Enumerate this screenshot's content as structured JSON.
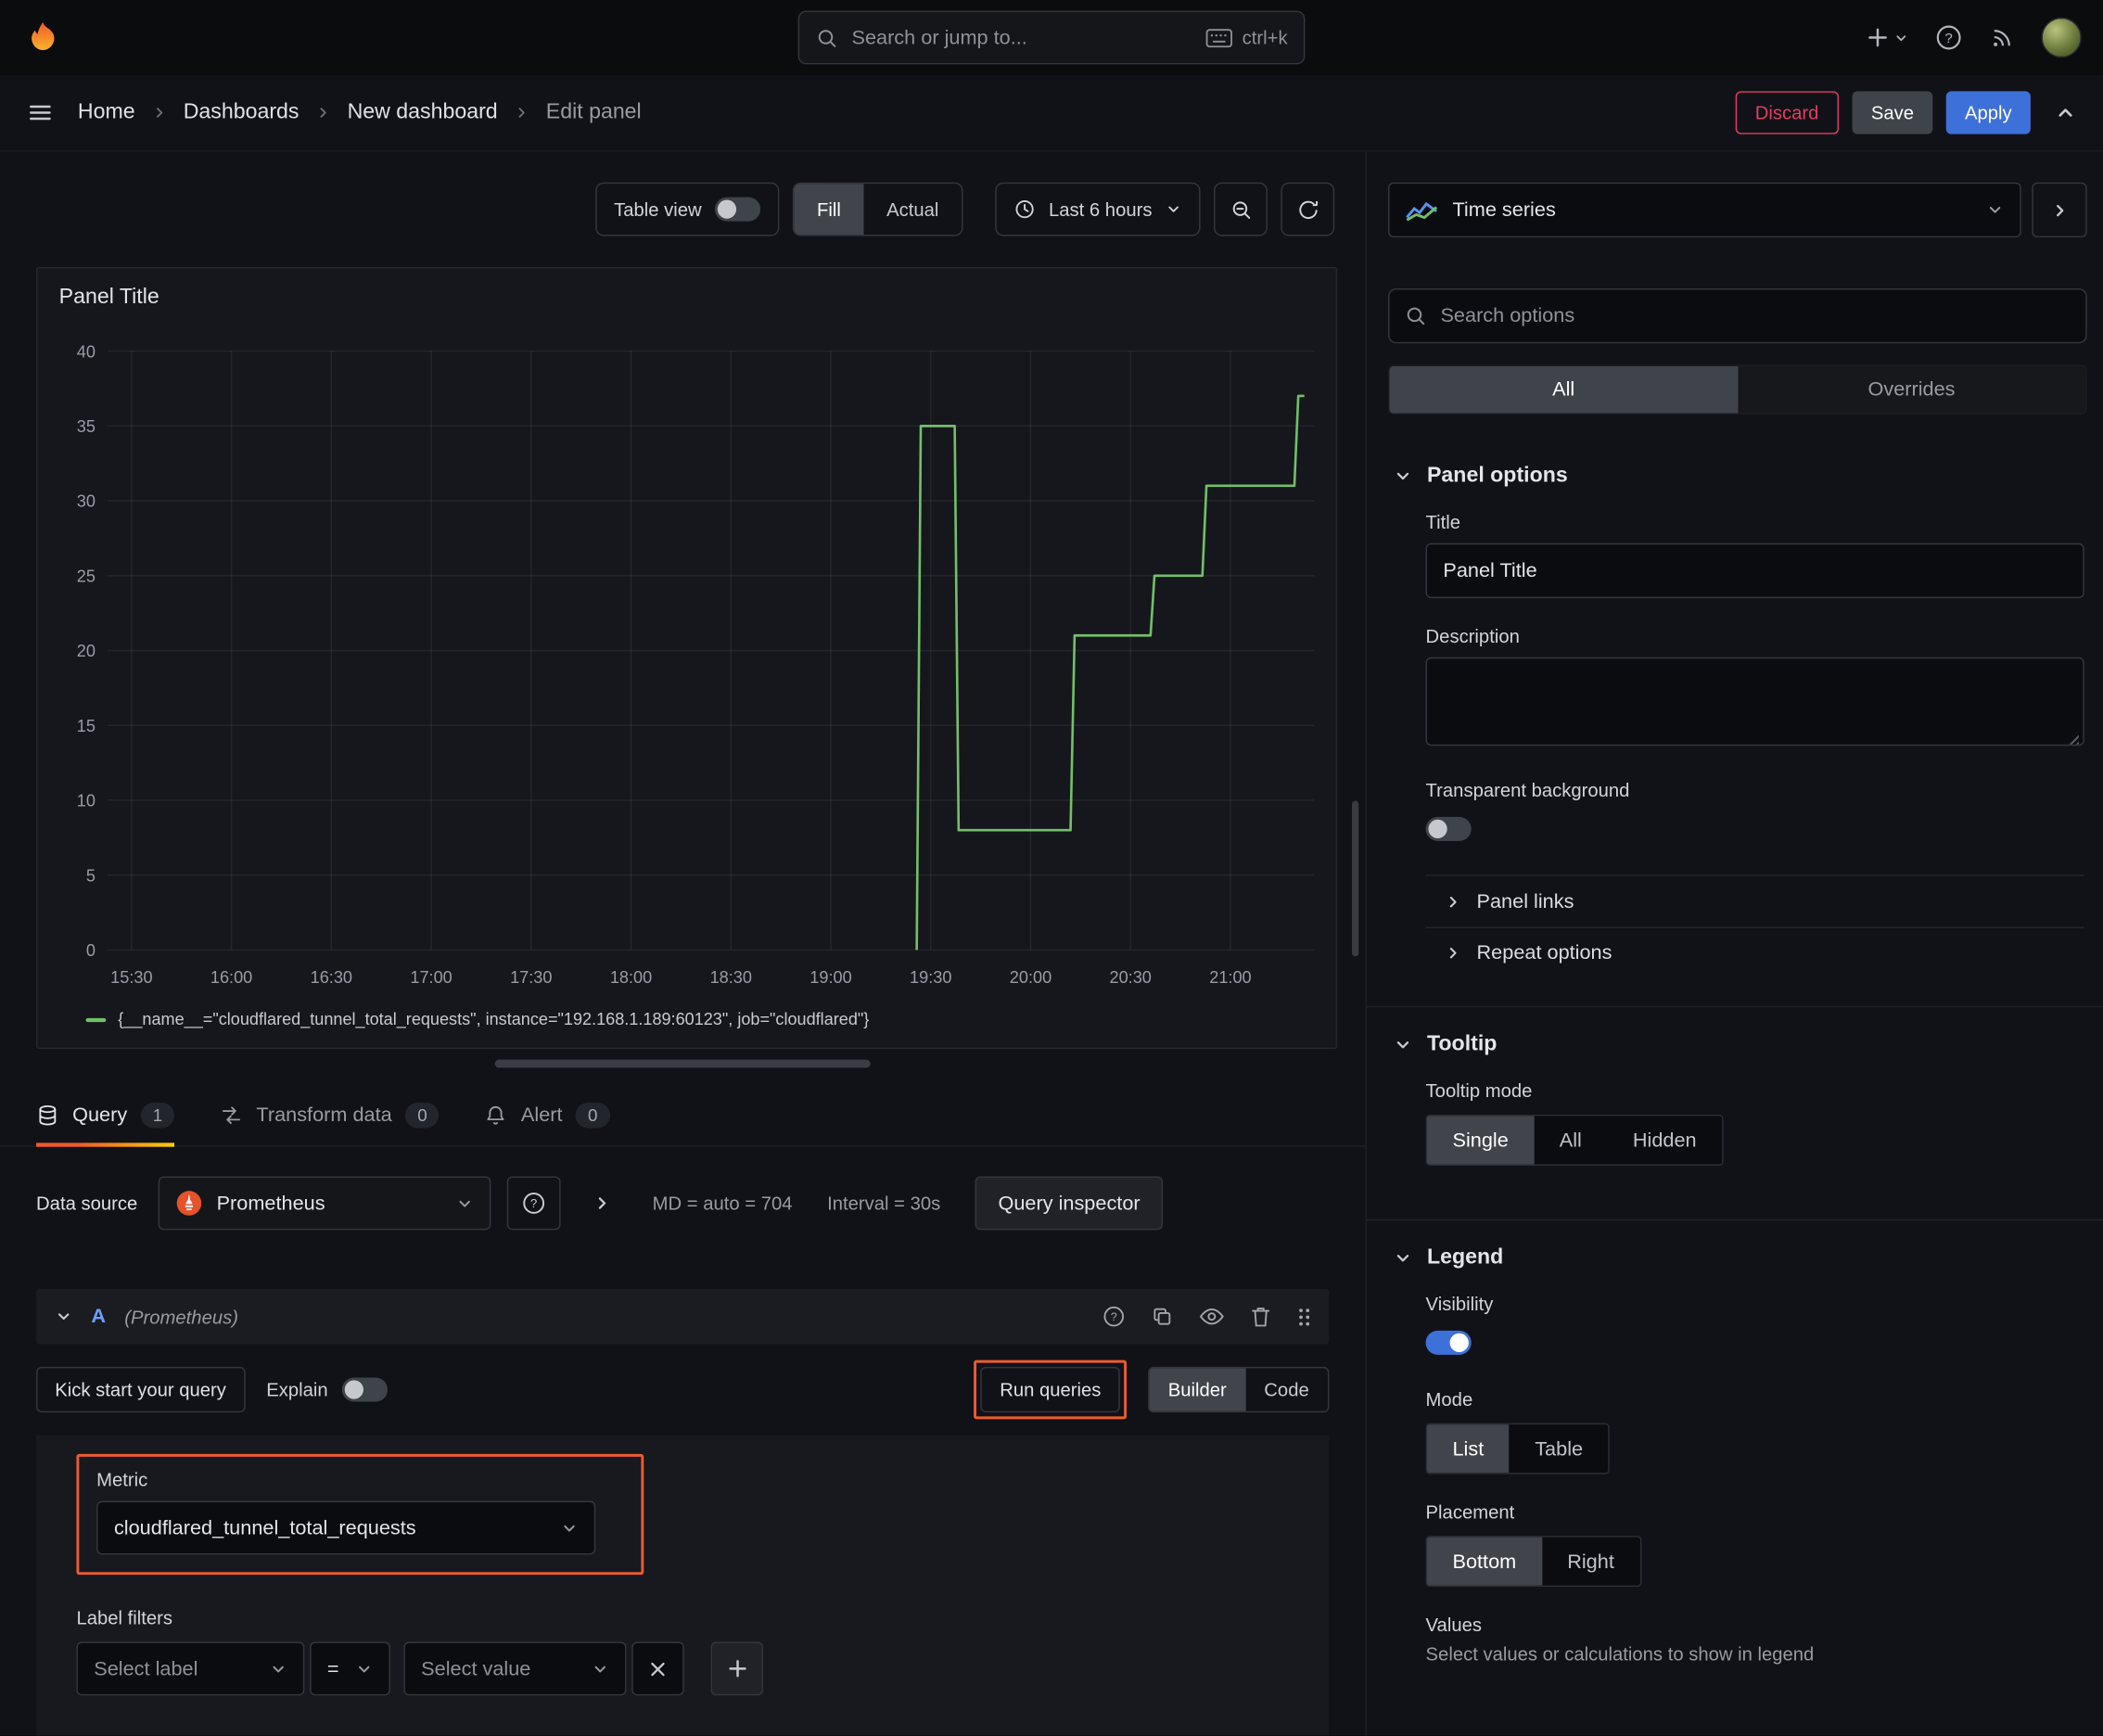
{
  "topbar": {
    "search_placeholder": "Search or jump to...",
    "shortcut": "ctrl+k"
  },
  "breadcrumb": {
    "items": [
      "Home",
      "Dashboards",
      "New dashboard",
      "Edit panel"
    ]
  },
  "actions": {
    "discard": "Discard",
    "save": "Save",
    "apply": "Apply"
  },
  "toolbar": {
    "table_view_label": "Table view",
    "fill": "Fill",
    "actual": "Actual",
    "time_range": "Last 6 hours"
  },
  "panel": {
    "title": "Panel Title"
  },
  "tabs": {
    "query": "Query",
    "query_count": "1",
    "transform": "Transform data",
    "transform_count": "0",
    "alert": "Alert",
    "alert_count": "0"
  },
  "query_editor": {
    "datasource_label": "Data source",
    "datasource": "Prometheus",
    "stats_md": "MD = auto = 704",
    "stats_interval": "Interval = 30s",
    "inspector": "Query inspector",
    "row_ref": "A",
    "row_ds": "(Prometheus)",
    "kickstart": "Kick start your query",
    "explain": "Explain",
    "run_queries": "Run queries",
    "builder": "Builder",
    "code": "Code",
    "metric_label": "Metric",
    "metric_value": "cloudflared_tunnel_total_requests",
    "label_filters": "Label filters",
    "select_label": "Select label",
    "operator": "=",
    "select_value": "Select value"
  },
  "options_pane": {
    "viz_name": "Time series",
    "search_placeholder": "Search options",
    "tab_all": "All",
    "tab_overrides": "Overrides",
    "panel_options": "Panel options",
    "title_label": "Title",
    "title_value": "Panel Title",
    "description_label": "Description",
    "transparent_bg": "Transparent background",
    "panel_links": "Panel links",
    "repeat_options": "Repeat options",
    "tooltip": "Tooltip",
    "tooltip_mode": "Tooltip mode",
    "tooltip_single": "Single",
    "tooltip_all": "All",
    "tooltip_hidden": "Hidden",
    "legend": "Legend",
    "visibility": "Visibility",
    "mode": "Mode",
    "mode_list": "List",
    "mode_table": "Table",
    "placement": "Placement",
    "placement_bottom": "Bottom",
    "placement_right": "Right",
    "values": "Values",
    "values_hint": "Select values or calculations to show in legend"
  },
  "colors": {
    "accent_blue": "#3d71d9",
    "series_green": "#73bf69",
    "annotation_orange": "#ee5b2e",
    "destructive_red": "#e23e63"
  },
  "icons": {
    "grafana-logo": "flame",
    "search-icon": "magnifier",
    "keyboard-icon": "keyboard",
    "add-icon": "plus",
    "help-icon": "question-circle",
    "news-icon": "rss",
    "menu-icon": "hamburger",
    "chevron-icons": "chevron up/down/right",
    "clock-icon": "clock",
    "zoom-out-icon": "magnifier-minus",
    "refresh-icon": "circular-arrow",
    "timeseries-icon": "sparklines",
    "query-icon": "database",
    "transform-icon": "swap-arrows",
    "alert-icon": "bell",
    "prometheus-icon": "torch",
    "copy-icon": "duplicate",
    "eye-icon": "eye",
    "trash-icon": "trash",
    "grip-icon": "drag-dots",
    "close-icon": "x"
  },
  "chart_data": {
    "type": "line",
    "title": "Panel Title",
    "step": true,
    "x_ticks": [
      "15:30",
      "16:00",
      "16:30",
      "17:00",
      "17:30",
      "18:00",
      "18:30",
      "19:00",
      "19:30",
      "20:00",
      "20:30",
      "21:00"
    ],
    "x_tick_hours": [
      15.5,
      16,
      16.5,
      17,
      17.5,
      18,
      18.5,
      19,
      19.5,
      20,
      20.5,
      21
    ],
    "x_range": [
      15.38,
      21.42
    ],
    "y_ticks": [
      0,
      5,
      10,
      15,
      20,
      25,
      30,
      35,
      40
    ],
    "ylim": [
      0,
      40
    ],
    "grid": true,
    "line_color": "#73bf69",
    "legend_position": "bottom",
    "series": [
      {
        "name": "{__name__=\"cloudflared_tunnel_total_requests\", instance=\"192.168.1.189:60123\", job=\"cloudflared\"}",
        "points": [
          [
            19.43,
            0
          ],
          [
            19.45,
            35
          ],
          [
            19.62,
            35
          ],
          [
            19.64,
            8
          ],
          [
            20.2,
            8
          ],
          [
            20.22,
            21
          ],
          [
            20.6,
            21
          ],
          [
            20.62,
            25
          ],
          [
            20.86,
            25
          ],
          [
            20.88,
            31
          ],
          [
            21.32,
            31
          ],
          [
            21.34,
            37
          ],
          [
            21.37,
            37
          ]
        ]
      }
    ]
  }
}
